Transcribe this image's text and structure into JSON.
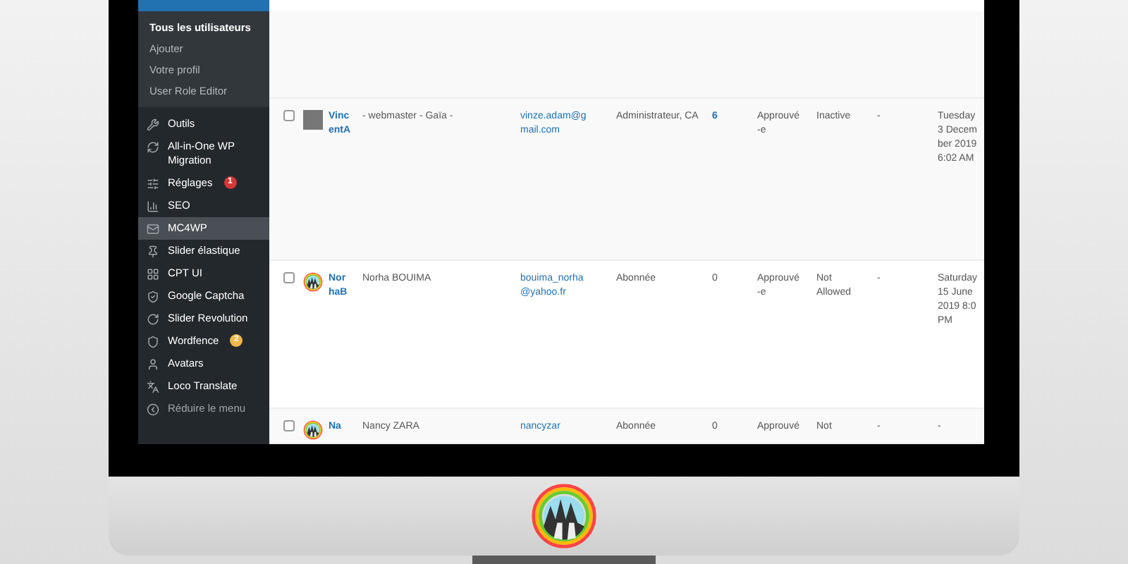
{
  "sidebar": {
    "submenu": [
      {
        "label": "Tous les utilisateurs",
        "selected": true
      },
      {
        "label": "Ajouter",
        "selected": false
      },
      {
        "label": "Votre profil",
        "selected": false
      },
      {
        "label": "User Role Editor",
        "selected": false
      }
    ],
    "menu": [
      {
        "label": "Outils",
        "kind": "wrench",
        "hovered": false
      },
      {
        "label": "All-in-One WP Migration",
        "kind": "sync",
        "hovered": false
      },
      {
        "label": "Réglages",
        "kind": "sliders",
        "hovered": false,
        "badge": {
          "text": "1",
          "color": "#d63638"
        }
      },
      {
        "label": "SEO",
        "kind": "seo",
        "hovered": false
      },
      {
        "label": "MC4WP",
        "kind": "mail",
        "hovered": true
      },
      {
        "label": "Slider élastique",
        "kind": "pin",
        "hovered": false
      },
      {
        "label": "CPT UI",
        "kind": "grid",
        "hovered": false
      },
      {
        "label": "Google Captcha",
        "kind": "captcha",
        "hovered": false
      },
      {
        "label": "Slider Revolution",
        "kind": "rotate",
        "hovered": false
      },
      {
        "label": "Wordfence",
        "kind": "shield",
        "hovered": false,
        "badge": {
          "text": "2",
          "color": "#f0b849"
        }
      },
      {
        "label": "Avatars",
        "kind": "user",
        "hovered": false
      },
      {
        "label": "Loco Translate",
        "kind": "translate",
        "hovered": false
      },
      {
        "label": "Réduire le menu",
        "kind": "collapse",
        "hovered": false
      }
    ]
  },
  "table": {
    "rows": [
      {
        "checked": false,
        "kind": "photo",
        "username": "VincentA",
        "name": "- webmaster - Gaïa -",
        "email": "vinze.adam@gmail.com",
        "role": "Administrateur, CA",
        "posts": "6",
        "posts_linked": true,
        "approval": "Approuvé -e",
        "status": "Inactive",
        "column_9": "-",
        "date": "Tuesday 3 December 2019 6:02 AM"
      },
      {
        "checked": false,
        "kind": "logo",
        "username": "NorhaB",
        "name": "Norha BOUIMA",
        "email": "bouima_norha@yahoo.fr",
        "role": "Abonnée",
        "posts": "0",
        "posts_linked": false,
        "approval": "Approuvé -e",
        "status": "Not Allowed",
        "column_9": "-",
        "date": "Saturday 15 June 2019 8:0 PM"
      },
      {
        "checked": false,
        "kind": "logo",
        "username": "Na",
        "name": "Nancy ZARA",
        "email": "nancyzar",
        "role": "Abonnée",
        "posts": "0",
        "posts_linked": false,
        "approval": "Approuvé",
        "status": "Not",
        "column_9": "-",
        "date": "-"
      }
    ]
  }
}
